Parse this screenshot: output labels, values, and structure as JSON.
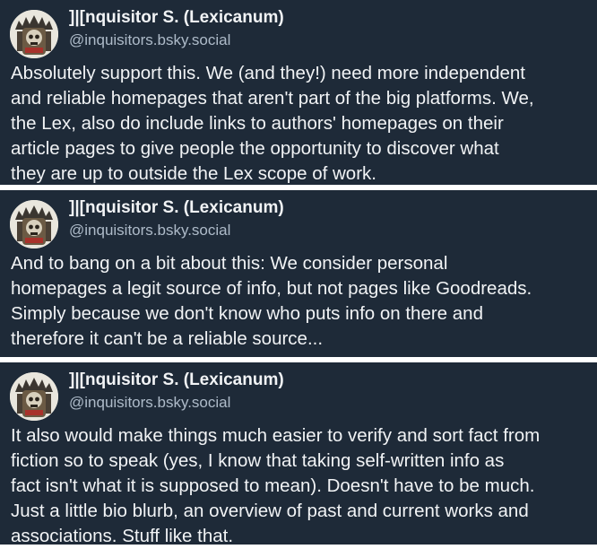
{
  "posts": [
    {
      "author": {
        "display_name": "]|[nquisitor S. (Lexicanum)",
        "handle": "@inquisitors.bsky.social",
        "avatar_icon": "inquisitor-skull-avatar-icon"
      },
      "lines": [
        "Absolutely support this. We (and they!) need more independent",
        "and reliable homepages that aren't part of the big platforms. We,",
        "the Lex, also do include links to authors' homepages on their",
        "article pages to give people the opportunity to discover what",
        "they are up to outside the Lex scope of work."
      ]
    },
    {
      "author": {
        "display_name": "]|[nquisitor S. (Lexicanum)",
        "handle": "@inquisitors.bsky.social",
        "avatar_icon": "inquisitor-skull-avatar-icon"
      },
      "lines": [
        "And to bang on a bit about this: We consider personal",
        "homepages a legit source of info, but not pages like Goodreads.",
        "Simply because we don't know who puts info on there and",
        "therefore it can't be a reliable source..."
      ]
    },
    {
      "author": {
        "display_name": "]|[nquisitor S. (Lexicanum)",
        "handle": "@inquisitors.bsky.social",
        "avatar_icon": "inquisitor-skull-avatar-icon"
      },
      "lines": [
        "It also would make things much easier to verify and sort fact from",
        "fiction so to speak (yes, I know that taking self-written info as",
        "fact isn't what it is supposed to mean). Doesn't have to be much.",
        "Just a little bio blurb, an overview of past and current works and",
        "associations. Stuff like that."
      ]
    }
  ],
  "colors": {
    "card_background": "#1e2a38",
    "separator": "#ffffff",
    "text_primary": "#f1f3f5",
    "text_secondary": "#aebbc9"
  }
}
